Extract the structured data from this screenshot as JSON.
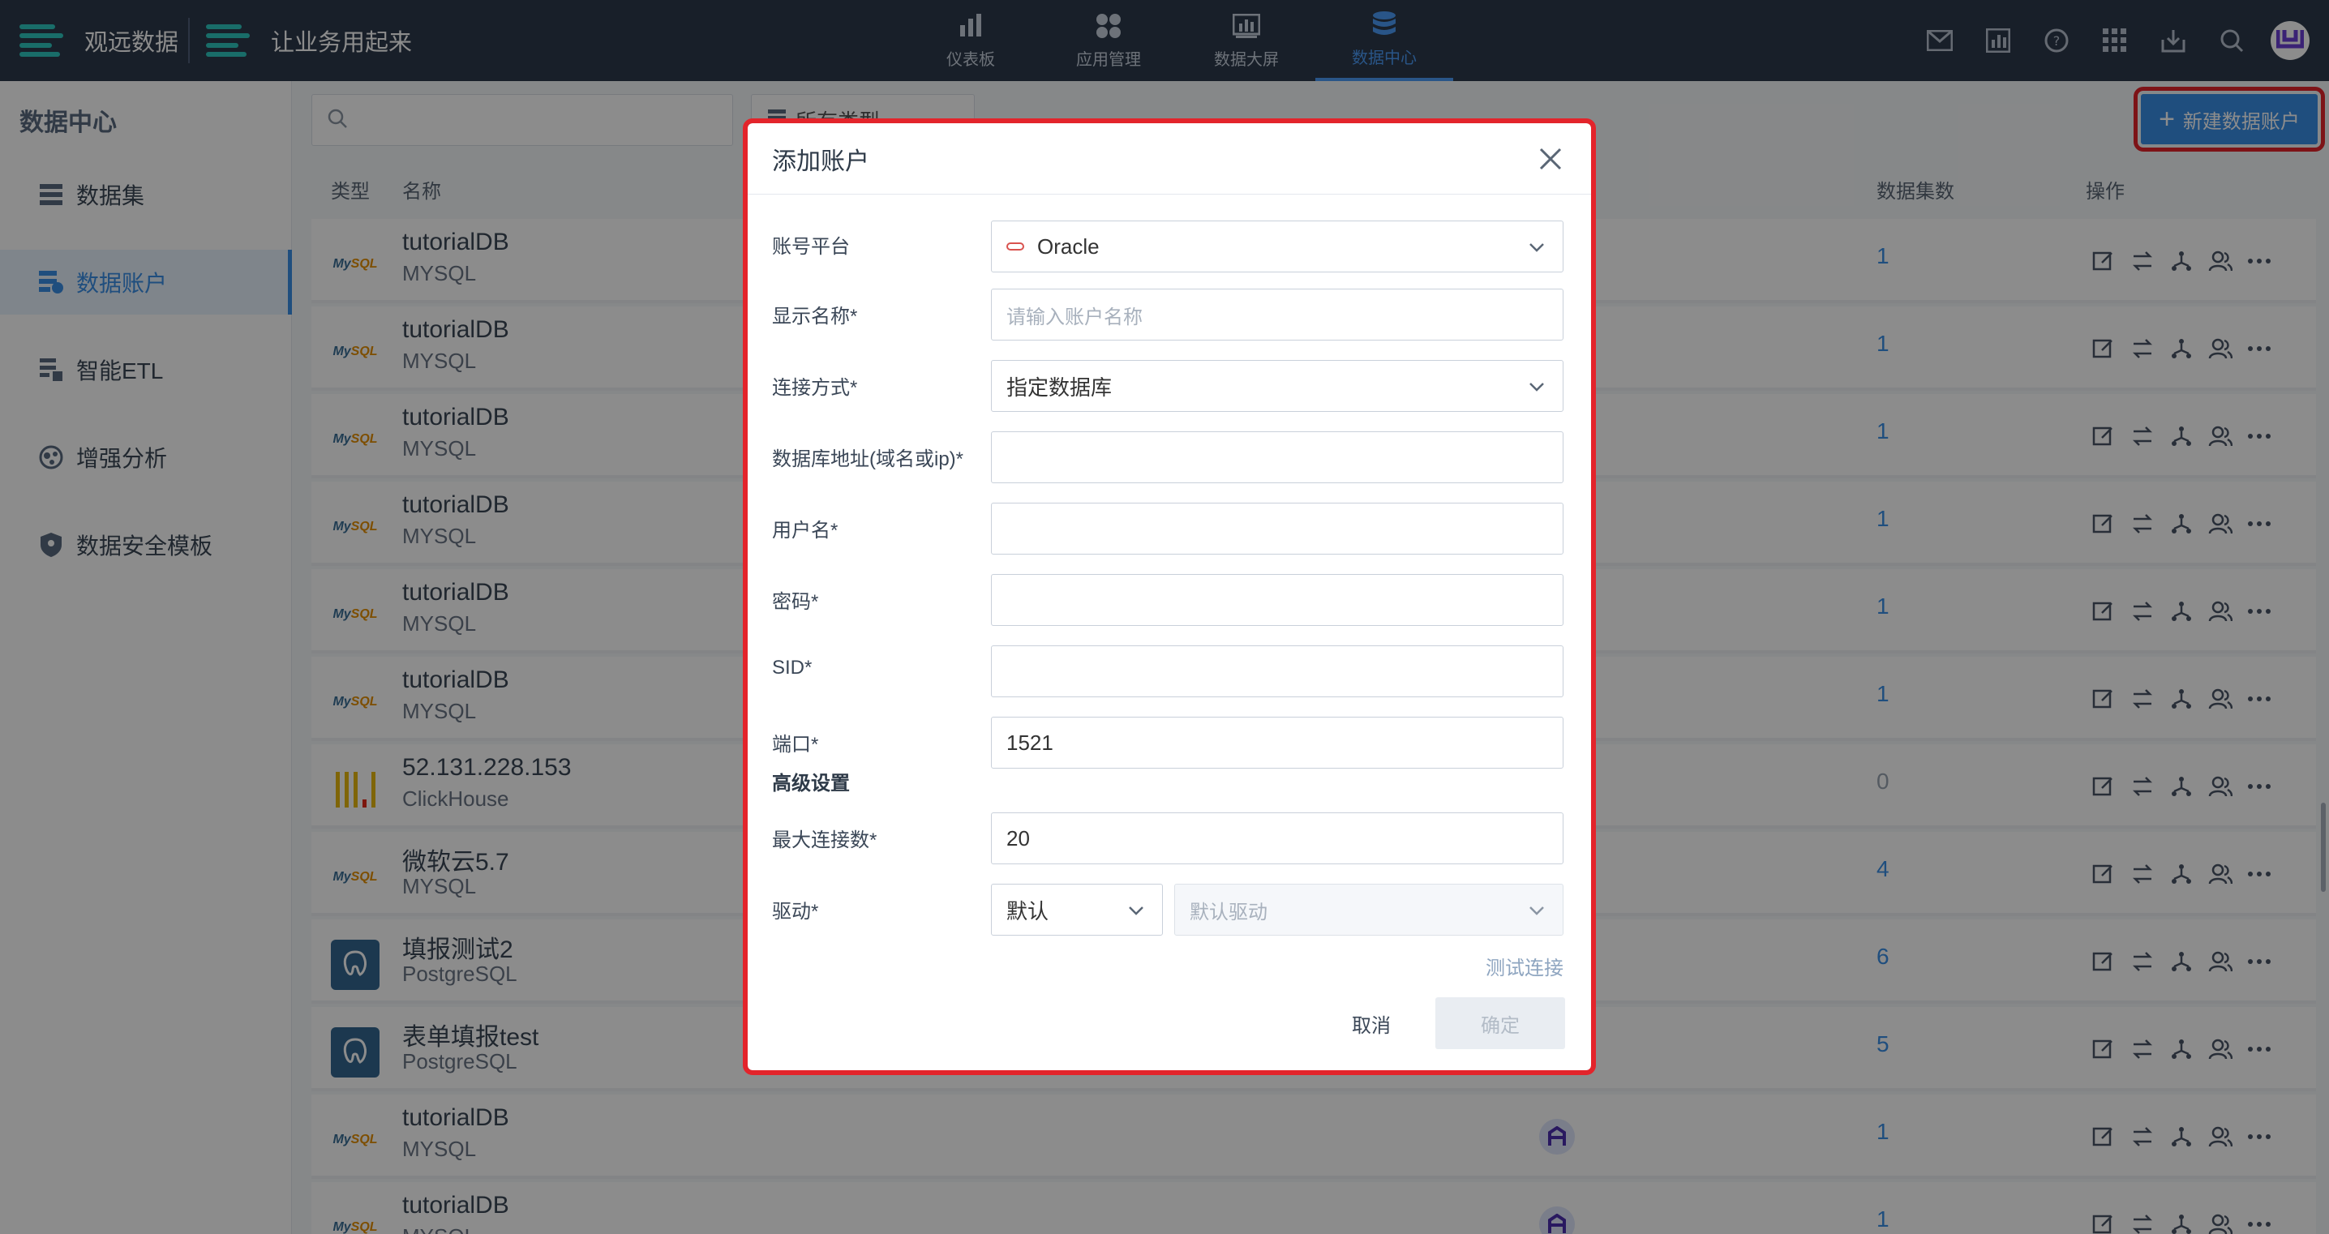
{
  "brand": {
    "name": "观远数据",
    "slogan": "让业务用起来"
  },
  "topnav": [
    {
      "label": "仪表板",
      "icon": "bar-chart-icon"
    },
    {
      "label": "应用管理",
      "icon": "apps-grid-icon"
    },
    {
      "label": "数据大屏",
      "icon": "screen-chart-icon"
    },
    {
      "label": "数据中心",
      "icon": "database-icon",
      "active": true
    }
  ],
  "tools": [
    "mail-icon",
    "dashboard-icon",
    "help-icon",
    "app-launcher-icon",
    "download-icon",
    "search-icon"
  ],
  "sidebar": {
    "title": "数据中心",
    "items": [
      {
        "label": "数据集",
        "icon": "dataset-icon"
      },
      {
        "label": "数据账户",
        "icon": "data-account-icon",
        "active": true
      },
      {
        "label": "智能ETL",
        "icon": "etl-icon"
      },
      {
        "label": "增强分析",
        "icon": "analysis-icon"
      },
      {
        "label": "数据安全模板",
        "icon": "shield-icon"
      }
    ]
  },
  "main": {
    "search_placeholder": "",
    "type_filter": "所有类型",
    "new_button": "新建数据账户",
    "columns": {
      "type": "类型",
      "name": "名称",
      "count": "数据集数",
      "actions": "操作"
    },
    "rows": [
      {
        "name": "tutorialDB",
        "type": "MYSQL",
        "logo": "mysql",
        "count": "1"
      },
      {
        "name": "tutorialDB",
        "type": "MYSQL",
        "logo": "mysql",
        "count": "1"
      },
      {
        "name": "tutorialDB",
        "type": "MYSQL",
        "logo": "mysql",
        "count": "1"
      },
      {
        "name": "tutorialDB",
        "type": "MYSQL",
        "logo": "mysql",
        "count": "1"
      },
      {
        "name": "tutorialDB",
        "type": "MYSQL",
        "logo": "mysql",
        "count": "1"
      },
      {
        "name": "tutorialDB",
        "type": "MYSQL",
        "logo": "mysql",
        "count": "1"
      },
      {
        "name": "52.131.228.153",
        "type": "ClickHouse",
        "logo": "clickhouse",
        "count": "0"
      },
      {
        "name": "微软云5.7",
        "type": "MYSQL",
        "logo": "mysql",
        "count": "4"
      },
      {
        "name": "填报测试2",
        "type": "PostgreSQL",
        "logo": "postgres",
        "count": "6"
      },
      {
        "name": "表单填报test",
        "type": "PostgreSQL",
        "logo": "postgres",
        "count": "5"
      },
      {
        "name": "tutorialDB",
        "type": "MYSQL",
        "logo": "mysql",
        "count": "1",
        "owner": true
      },
      {
        "name": "tutorialDB",
        "type": "MYSQL",
        "logo": "mysql",
        "count": "1",
        "owner": true
      }
    ]
  },
  "modal": {
    "title": "添加账户",
    "fields": {
      "platform": {
        "label": "账号平台",
        "value": "Oracle"
      },
      "display_name": {
        "label": "显示名称*",
        "placeholder": "请输入账户名称"
      },
      "connect_mode": {
        "label": "连接方式*",
        "value": "指定数据库"
      },
      "host": {
        "label": "数据库地址(域名或ip)*",
        "value": ""
      },
      "username": {
        "label": "用户名*",
        "value": ""
      },
      "password": {
        "label": "密码*",
        "value": ""
      },
      "sid": {
        "label": "SID*",
        "value": ""
      },
      "port": {
        "label": "端口*",
        "value": "1521"
      },
      "advanced": "高级设置",
      "max_conn": {
        "label": "最大连接数*",
        "value": "20"
      },
      "driver": {
        "label": "驱动*",
        "value": "默认",
        "driver_placeholder": "默认驱动"
      }
    },
    "test_link": "测试连接",
    "cancel": "取消",
    "confirm": "确定"
  },
  "colors": {
    "topbar": "#2d3a4b",
    "accent": "#3a8ee6",
    "highlight": "#e3242b"
  }
}
